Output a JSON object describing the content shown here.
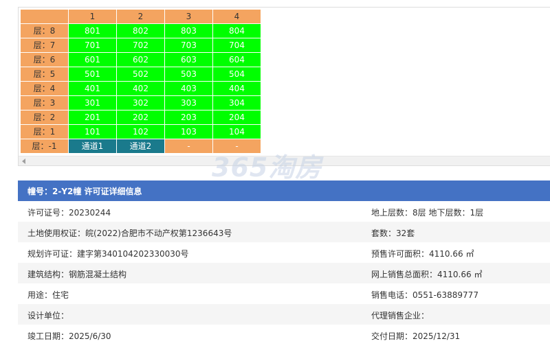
{
  "grid": {
    "columns": [
      "1",
      "2",
      "3",
      "4"
    ],
    "rows": [
      {
        "floor": "层：8",
        "units": [
          "801",
          "802",
          "803",
          "804"
        ],
        "type": "unit"
      },
      {
        "floor": "层：7",
        "units": [
          "701",
          "702",
          "703",
          "704"
        ],
        "type": "unit"
      },
      {
        "floor": "层：6",
        "units": [
          "601",
          "602",
          "603",
          "604"
        ],
        "type": "unit"
      },
      {
        "floor": "层：5",
        "units": [
          "501",
          "502",
          "503",
          "504"
        ],
        "type": "unit"
      },
      {
        "floor": "层：4",
        "units": [
          "401",
          "402",
          "403",
          "404"
        ],
        "type": "unit"
      },
      {
        "floor": "层：3",
        "units": [
          "301",
          "302",
          "303",
          "304"
        ],
        "type": "unit"
      },
      {
        "floor": "层：2",
        "units": [
          "201",
          "202",
          "203",
          "204"
        ],
        "type": "unit"
      },
      {
        "floor": "层：1",
        "units": [
          "101",
          "102",
          "103",
          "104"
        ],
        "type": "unit"
      },
      {
        "floor": "层：-1",
        "units": [
          "通道1",
          "通道2",
          "-",
          "-"
        ],
        "type": "basement"
      }
    ]
  },
  "watermark": {
    "logo": "365淘房",
    "url": "www.house365.com"
  },
  "detail": {
    "title": "幢号：2-Y2幢 许可证详细信息",
    "rows": [
      {
        "left": "许可证号：20230244",
        "right": "地上层数：8层  地下层数：1层"
      },
      {
        "left": "土地使用权证：皖(2022)合肥市不动产权第1236643号",
        "right": "套数：32套"
      },
      {
        "left": "规划许可证：建字第340104202330030号",
        "right": "预售许可面积：4110.66 ㎡"
      },
      {
        "left": "建筑结构：钢筋混凝土结构",
        "right": "网上销售总面积：4110.66 ㎡"
      },
      {
        "left": "用途：住宅",
        "right": "销售电话：0551-63889777"
      },
      {
        "left": "设计单位：",
        "right": "代理销售企业："
      },
      {
        "left": "竣工日期：2025/6/30",
        "right": "交付日期：2025/12/31"
      }
    ]
  },
  "colors": {
    "header_orange": "#f4a460",
    "available_green": "#00ff00",
    "passage_teal": "#1a7a8c",
    "detail_header_blue": "#4472c4"
  }
}
